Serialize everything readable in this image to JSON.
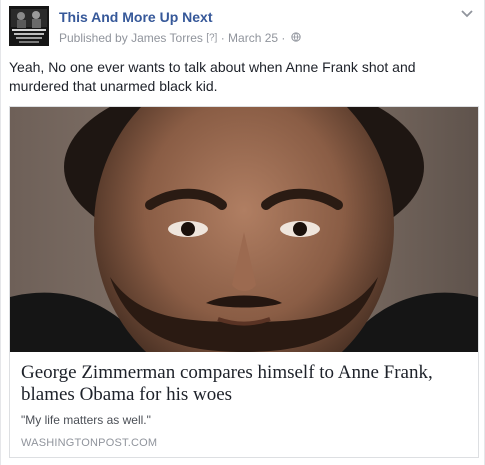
{
  "post": {
    "page_name": "This And More Up Next",
    "published_by_prefix": "Published by",
    "author": "James Torres",
    "author_help": "[?]",
    "separator": "·",
    "date": "March 25",
    "privacy_icon": "globe-icon",
    "options_icon": "chevron-down-icon",
    "text": "Yeah, No one ever wants to talk about when Anne Frank shot and murdered that unarmed black kid."
  },
  "link_preview": {
    "title": "George Zimmerman compares himself to Anne Frank, blames Obama for his woes",
    "description": "\"My life matters as well.\"",
    "domain": "WASHINGTONPOST.COM"
  },
  "colors": {
    "page_name": "#365899",
    "meta": "#90949c",
    "text": "#1d2129",
    "border": "#dddfe2"
  }
}
